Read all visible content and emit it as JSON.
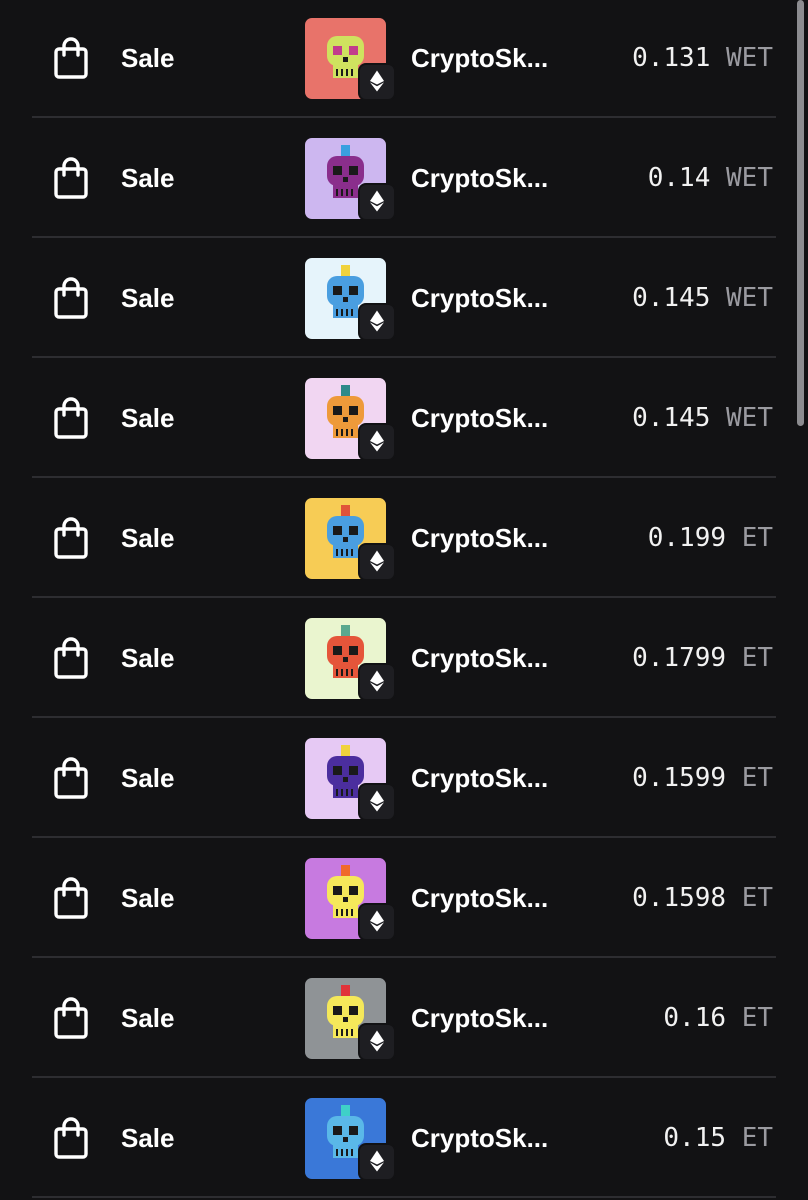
{
  "colors": {
    "background": "#121214",
    "divider": "#2d2d31",
    "text_primary": "#ffffff",
    "text_secondary": "#9a9aa0"
  },
  "activity": [
    {
      "type": "Sale",
      "icon": "shopping-bag-icon",
      "item_name": "CryptoSk...",
      "chain_icon": "ethereum-icon",
      "price": "0.131",
      "currency": "WET",
      "thumb_bg": "#e8736a",
      "skull_color": "#cfe25f",
      "hair_color": "",
      "eye_color": "#c23c8c"
    },
    {
      "type": "Sale",
      "icon": "shopping-bag-icon",
      "item_name": "CryptoSk...",
      "chain_icon": "ethereum-icon",
      "price": "0.14",
      "currency": "WET",
      "thumb_bg": "#cdb7f0",
      "skull_color": "#8a2e8c",
      "hair_color": "#3aa0e0",
      "eye_color": "#1a1a1a"
    },
    {
      "type": "Sale",
      "icon": "shopping-bag-icon",
      "item_name": "CryptoSk...",
      "chain_icon": "ethereum-icon",
      "price": "0.145",
      "currency": "WET",
      "thumb_bg": "#e6f4fb",
      "skull_color": "#4a9ee0",
      "hair_color": "#f0d23c",
      "eye_color": "#1a1a1a"
    },
    {
      "type": "Sale",
      "icon": "shopping-bag-icon",
      "item_name": "CryptoSk...",
      "chain_icon": "ethereum-icon",
      "price": "0.145",
      "currency": "WET",
      "thumb_bg": "#f1d6f2",
      "skull_color": "#ee9a3a",
      "hair_color": "#2e8a8a",
      "eye_color": "#1a1a1a"
    },
    {
      "type": "Sale",
      "icon": "shopping-bag-icon",
      "item_name": "CryptoSk...",
      "chain_icon": "ethereum-icon",
      "price": "0.199",
      "currency": "ET",
      "thumb_bg": "#f7cc55",
      "skull_color": "#4a9ee0",
      "hair_color": "#e0533a",
      "eye_color": "#1a1a1a"
    },
    {
      "type": "Sale",
      "icon": "shopping-bag-icon",
      "item_name": "CryptoSk...",
      "chain_icon": "ethereum-icon",
      "price": "0.1799",
      "currency": "ET",
      "thumb_bg": "#eaf5cf",
      "skull_color": "#e5553a",
      "hair_color": "#5aa88e",
      "eye_color": "#1a1a1a"
    },
    {
      "type": "Sale",
      "icon": "shopping-bag-icon",
      "item_name": "CryptoSk...",
      "chain_icon": "ethereum-icon",
      "price": "0.1599",
      "currency": "ET",
      "thumb_bg": "#e6c9f4",
      "skull_color": "#4b2e9e",
      "hair_color": "#f0d23c",
      "eye_color": "#1a1a1a"
    },
    {
      "type": "Sale",
      "icon": "shopping-bag-icon",
      "item_name": "CryptoSk...",
      "chain_icon": "ethereum-icon",
      "price": "0.1598",
      "currency": "ET",
      "thumb_bg": "#c77ae0",
      "skull_color": "#f5e85a",
      "hair_color": "#f06a2a",
      "eye_color": "#1a1a1a"
    },
    {
      "type": "Sale",
      "icon": "shopping-bag-icon",
      "item_name": "CryptoSk...",
      "chain_icon": "ethereum-icon",
      "price": "0.16",
      "currency": "ET",
      "thumb_bg": "#8f9396",
      "skull_color": "#f5e85a",
      "hair_color": "#e0333a",
      "eye_color": "#1a1a1a"
    },
    {
      "type": "Sale",
      "icon": "shopping-bag-icon",
      "item_name": "CryptoSk...",
      "chain_icon": "ethereum-icon",
      "price": "0.15",
      "currency": "ET",
      "thumb_bg": "#3a78d8",
      "skull_color": "#5ab8e8",
      "hair_color": "#3fd0c8",
      "eye_color": "#1a1a1a"
    }
  ]
}
